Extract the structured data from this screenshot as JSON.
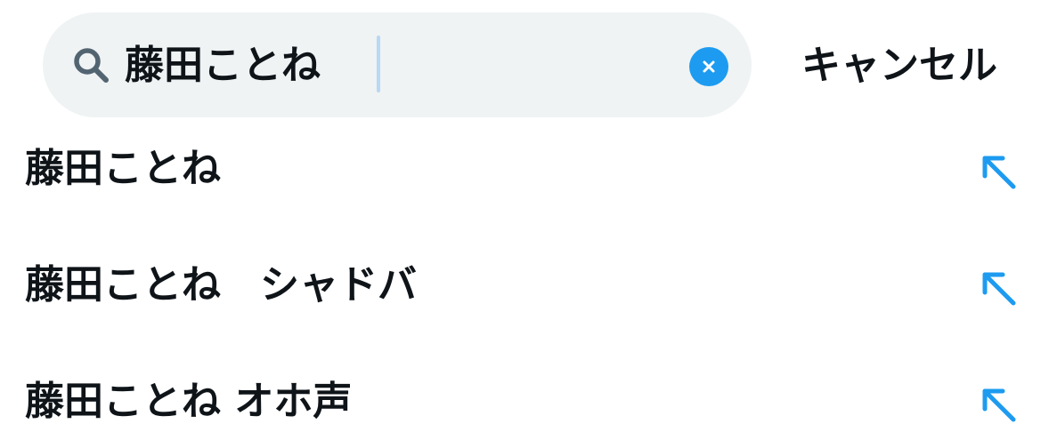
{
  "search": {
    "query": "藤田ことね",
    "clear_icon": "close-circle-icon",
    "search_icon": "magnifier-icon"
  },
  "header": {
    "cancel_label": "キャンセル"
  },
  "suggestions": [
    {
      "label": "藤田ことね",
      "icon": "arrow-up-left-icon"
    },
    {
      "label": "藤田ことね　シャドバ",
      "icon": "arrow-up-left-icon"
    },
    {
      "label": "藤田ことね オホ声",
      "icon": "arrow-up-left-icon"
    }
  ],
  "colors": {
    "accent": "#1d9bf0",
    "search_background": "#eff3f4",
    "text": "#0f1419",
    "icon_gray": "#536471"
  }
}
